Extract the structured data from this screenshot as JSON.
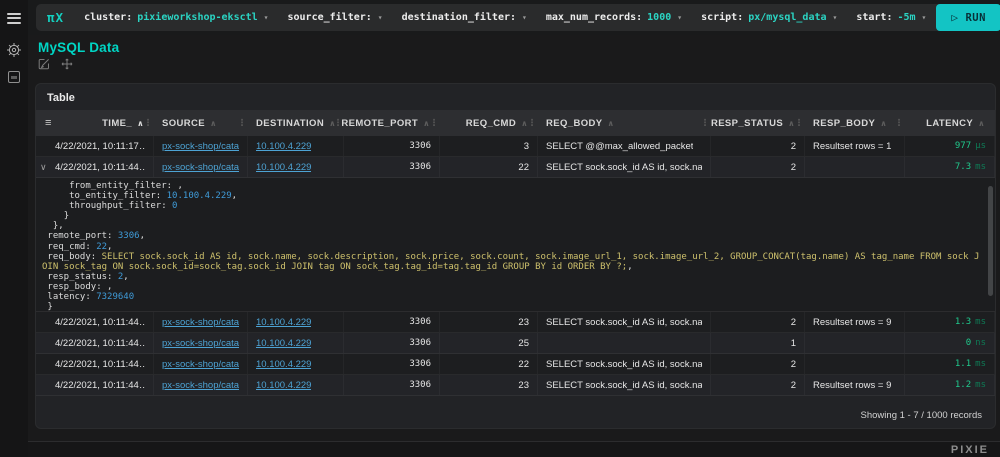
{
  "icons": {
    "caret_down": "▾",
    "sort_up": "∧",
    "col_menu": "⋮",
    "table_menu": "≡",
    "chevron_down": "∨",
    "play": "▷"
  },
  "colors": {
    "accent_teal": "#00d5c4",
    "link_blue": "#4da3d4",
    "latency_green": "#1fc98c",
    "number_blue": "#3f9bd8",
    "string_yellow": "#cdc06c",
    "run_button": "#13c4c4"
  },
  "topbar": {
    "logo": "πX",
    "items": [
      {
        "label": "cluster:",
        "value": "pixieworkshop-eksctl"
      },
      {
        "label": "source_filter:",
        "value": ""
      },
      {
        "label": "destination_filter:",
        "value": ""
      },
      {
        "label": "max_num_records:",
        "value": "1000"
      },
      {
        "label": "script:",
        "value": "px/mysql_data"
      }
    ],
    "start_label": "start:",
    "start_value": "-5m",
    "run_label": "RUN"
  },
  "page": {
    "title": "MySQL Data"
  },
  "panel": {
    "title": "Table",
    "footer": "Showing 1 - 7 / 1000 records"
  },
  "table": {
    "columns": [
      {
        "label": "TIME_",
        "align": "right",
        "sorted": true
      },
      {
        "label": "SOURCE",
        "align": "left",
        "sorted": false
      },
      {
        "label": "DESTINATION",
        "align": "left",
        "sorted": false
      },
      {
        "label": "REMOTE_PORT",
        "align": "right",
        "sorted": false
      },
      {
        "label": "REQ_CMD",
        "align": "right",
        "sorted": false
      },
      {
        "label": "REQ_BODY",
        "align": "left",
        "sorted": false
      },
      {
        "label": "RESP_STATUS",
        "align": "right",
        "sorted": false
      },
      {
        "label": "RESP_BODY",
        "align": "left",
        "sorted": false
      },
      {
        "label": "LATENCY",
        "align": "right",
        "sorted": false
      }
    ],
    "rows": [
      {
        "expanded": false,
        "time": "4/22/2021, 10:11:17…",
        "source": "px-sock-shop/catalo…",
        "destination": "10.100.4.229",
        "remote_port": "3306",
        "req_cmd": "3",
        "req_body": "SELECT @@max_allowed_packet",
        "resp_status": "2",
        "resp_body": "Resultset rows = 1",
        "latency_value": "977",
        "latency_unit": "µs"
      },
      {
        "expanded": true,
        "time": "4/22/2021, 10:11:44…",
        "source": "px-sock-shop/catalo…",
        "destination": "10.100.4.229",
        "remote_port": "3306",
        "req_cmd": "22",
        "req_body": "SELECT sock.sock_id AS id, sock.name,…",
        "resp_status": "2",
        "resp_body": "",
        "latency_value": "7.3",
        "latency_unit": "ms"
      },
      {
        "expanded": false,
        "time": "4/22/2021, 10:11:44…",
        "source": "px-sock-shop/catalo…",
        "destination": "10.100.4.229",
        "remote_port": "3306",
        "req_cmd": "23",
        "req_body": "SELECT sock.sock_id AS id, sock.name,…",
        "resp_status": "2",
        "resp_body": "Resultset rows = 9",
        "latency_value": "1.3",
        "latency_unit": "ms"
      },
      {
        "expanded": false,
        "time": "4/22/2021, 10:11:44…",
        "source": "px-sock-shop/catalo…",
        "destination": "10.100.4.229",
        "remote_port": "3306",
        "req_cmd": "25",
        "req_body": "",
        "resp_status": "1",
        "resp_body": "",
        "latency_value": "0",
        "latency_unit": "ns"
      },
      {
        "expanded": false,
        "time": "4/22/2021, 10:11:44…",
        "source": "px-sock-shop/catalo…",
        "destination": "10.100.4.229",
        "remote_port": "3306",
        "req_cmd": "22",
        "req_body": "SELECT sock.sock_id AS id, sock.name,…",
        "resp_status": "2",
        "resp_body": "",
        "latency_value": "1.1",
        "latency_unit": "ms"
      },
      {
        "expanded": false,
        "time": "4/22/2021, 10:11:44…",
        "source": "px-sock-shop/catalo…",
        "destination": "10.100.4.229",
        "remote_port": "3306",
        "req_cmd": "23",
        "req_body": "SELECT sock.sock_id AS id, sock.name,…",
        "resp_status": "2",
        "resp_body": "Resultset rows = 9",
        "latency_value": "1.2",
        "latency_unit": "ms"
      }
    ]
  },
  "detail": {
    "lines": [
      [
        [
          "w",
          "     from_entity_filter: ,"
        ]
      ],
      [
        [
          "w",
          "     to_entity_filter: "
        ],
        [
          "n",
          "10.100.4.229"
        ],
        [
          "w",
          ","
        ]
      ],
      [
        [
          "w",
          "     throughput_filter: "
        ],
        [
          "n",
          "0"
        ]
      ],
      [
        [
          "w",
          "    }"
        ]
      ],
      [
        [
          "w",
          "  },"
        ]
      ],
      [
        [
          "w",
          " remote_port: "
        ],
        [
          "n",
          "3306"
        ],
        [
          "w",
          ","
        ]
      ],
      [
        [
          "w",
          " req_cmd: "
        ],
        [
          "n",
          "22"
        ],
        [
          "w",
          ","
        ]
      ],
      [
        [
          "w",
          " req_body: "
        ],
        [
          "s",
          "SELECT sock.sock_id AS id, sock.name, sock.description, sock.price, sock.count, sock.image_url_1, sock.image_url_2, GROUP_CONCAT(tag.name) AS tag_name FROM sock JOIN sock_tag ON sock.sock_id=sock_tag.sock_id JOIN tag ON sock_tag.tag_id=tag.tag_id GROUP BY id ORDER BY ?;"
        ],
        [
          "w",
          ","
        ]
      ],
      [
        [
          "w",
          " resp_status: "
        ],
        [
          "n",
          "2"
        ],
        [
          "w",
          ","
        ]
      ],
      [
        [
          "w",
          " resp_body: ,"
        ]
      ],
      [
        [
          "w",
          " latency: "
        ],
        [
          "n",
          "7329640"
        ]
      ],
      [
        [
          "w",
          " }"
        ]
      ]
    ]
  },
  "footer": {
    "brand": "PIXIE"
  }
}
